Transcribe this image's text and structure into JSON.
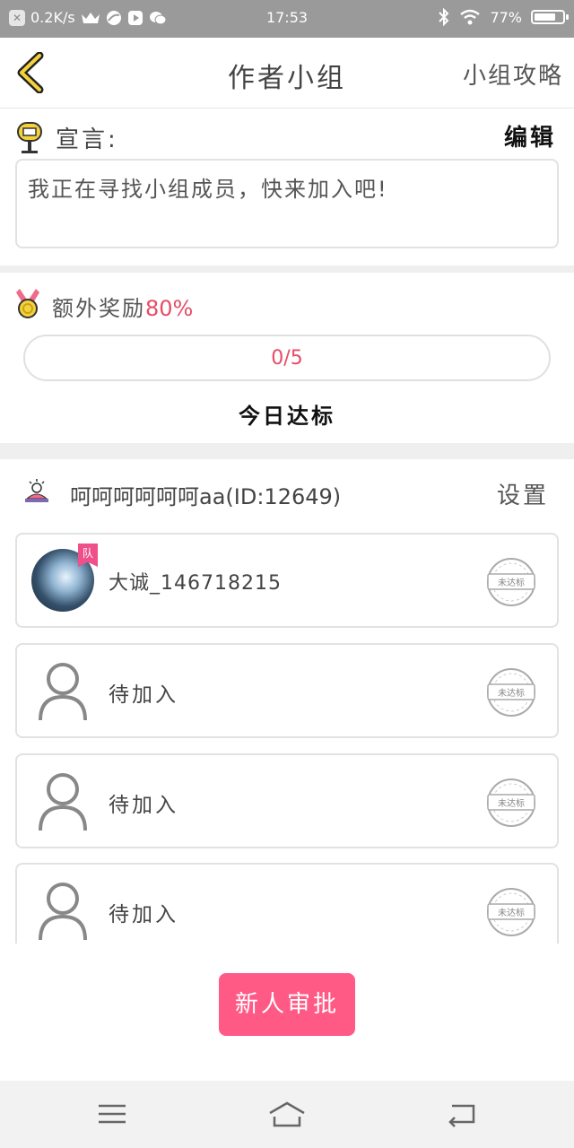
{
  "status_bar": {
    "speed": "0.2K/s",
    "time": "17:53",
    "battery": "77%",
    "battery_level": 0.77
  },
  "nav": {
    "title": "作者小组",
    "right_label": "小组攻略"
  },
  "declaration": {
    "label": "宣言:",
    "edit_label": "编辑",
    "text": "我正在寻找小组成员，快来加入吧!"
  },
  "reward": {
    "label": "额外奖励",
    "percent": "80%",
    "progress_text": "0/5",
    "progress_value": 0,
    "today_label": "今日达标"
  },
  "team": {
    "name": "呵呵呵呵呵呵aa(ID:12649)",
    "settings_label": "设置",
    "members": [
      {
        "name": "大诚_146718215",
        "badge": "队",
        "status": "未达标"
      },
      {
        "name": "待加入",
        "status": "未达标"
      },
      {
        "name": "待加入",
        "status": "未达标"
      },
      {
        "name": "待加入",
        "status": "未达标"
      }
    ]
  },
  "approve_button": "新人审批",
  "colors": {
    "accent": "#ff5a86",
    "accent_text": "#e64c66"
  }
}
